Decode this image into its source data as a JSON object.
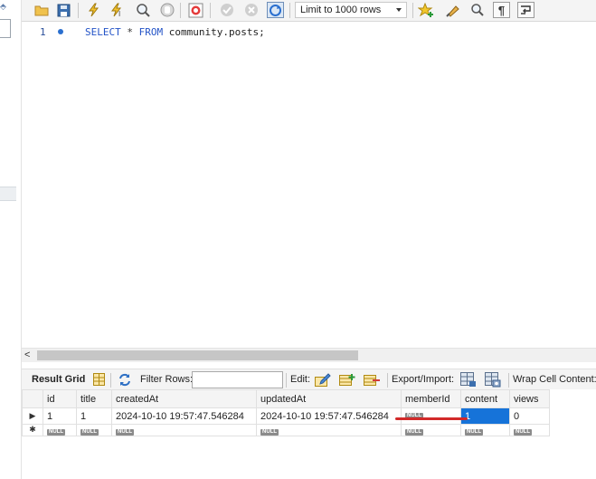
{
  "toolbar": {
    "limit_label": "Limit to 1000 rows",
    "buttons": [
      "open-folder-icon",
      "save-icon",
      "execute-icon",
      "execute-current-icon",
      "explain-icon",
      "stop-icon",
      "toggle-error-icon",
      "commit-icon",
      "rollback-icon",
      "autocommit-icon",
      "beautify-icon",
      "snippet-icon",
      "find-icon",
      "invisible-chars-icon",
      "wrap-icon"
    ]
  },
  "editor": {
    "line_number": "1",
    "sql": {
      "kw1": "SELECT",
      "star": " * ",
      "kw2": "FROM",
      "table": " community.posts;"
    }
  },
  "scrollbar": {
    "left_arrow": "<"
  },
  "result_toolbar": {
    "result_grid": "Result Grid",
    "filter_rows": "Filter Rows:",
    "edit": "Edit:",
    "export_import": "Export/Import:",
    "wrap_cell": "Wrap Cell Content:"
  },
  "grid": {
    "columns": [
      "id",
      "title",
      "createdAt",
      "updatedAt",
      "memberId",
      "content",
      "views"
    ],
    "row": {
      "id": "1",
      "title": "1",
      "createdAt": "2024-10-10 19:57:47.546284",
      "updatedAt": "2024-10-10 19:57:47.546284",
      "memberId": "NULL",
      "content": "1",
      "views": "0"
    },
    "null_label": "NULL",
    "row_marker": "▶",
    "new_row_marker": "✱"
  },
  "colors": {
    "accent_selected": "#1673d9",
    "annotation_red": "#d22a2a",
    "keyword_blue": "#2454c7"
  }
}
